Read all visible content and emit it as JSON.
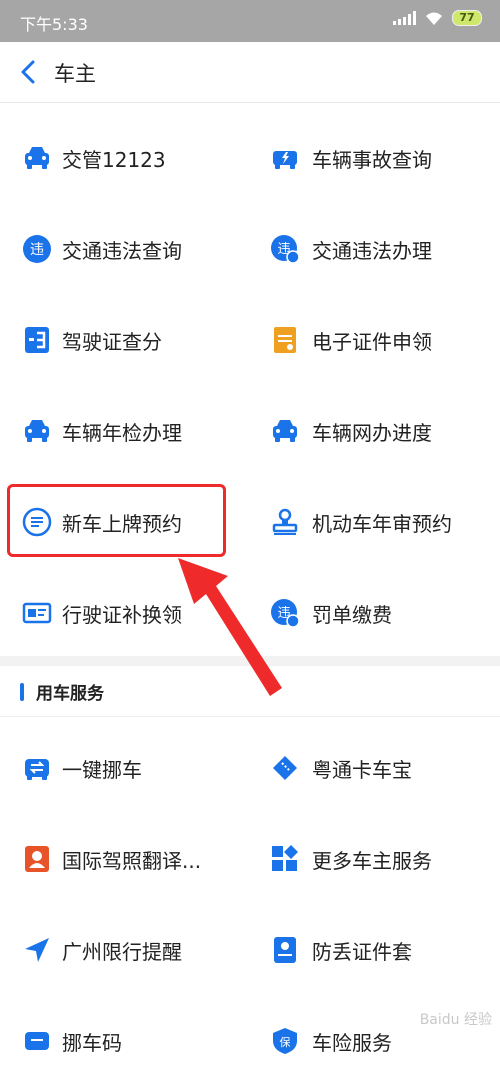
{
  "status": {
    "time": "下午5:33",
    "battery": "77"
  },
  "nav": {
    "title": "车主"
  },
  "services": [
    {
      "label": "交管12123",
      "icon": "car-icon"
    },
    {
      "label": "车辆事故查询",
      "icon": "car-accident-icon"
    },
    {
      "label": "交通违法查询",
      "icon": "violation-icon"
    },
    {
      "label": "交通违法办理",
      "icon": "violation-handle-icon"
    },
    {
      "label": "驾驶证查分",
      "icon": "license-points-icon"
    },
    {
      "label": "电子证件申领",
      "icon": "e-certificate-icon"
    },
    {
      "label": "车辆年检办理",
      "icon": "car-icon"
    },
    {
      "label": "车辆网办进度",
      "icon": "car-icon"
    },
    {
      "label": "新车上牌预约",
      "icon": "list-circle-icon"
    },
    {
      "label": "机动车年审预约",
      "icon": "stamp-icon"
    },
    {
      "label": "行驶证补换领",
      "icon": "id-card-icon"
    },
    {
      "label": "罚单缴费",
      "icon": "violation-pay-icon"
    }
  ],
  "car_services": {
    "title": "用车服务",
    "items": [
      {
        "label": "一键挪车",
        "icon": "move-car-icon"
      },
      {
        "label": "粤通卡车宝",
        "icon": "ticket-icon"
      },
      {
        "label": "国际驾照翻译...",
        "icon": "person-card-icon"
      },
      {
        "label": "更多车主服务",
        "icon": "grid-plus-icon"
      },
      {
        "label": "广州限行提醒",
        "icon": "navigation-arrow-icon"
      },
      {
        "label": "防丢证件套",
        "icon": "card-holder-icon"
      },
      {
        "label": "挪车码",
        "icon": "car-code-icon"
      },
      {
        "label": "车险服务",
        "icon": "insurance-icon"
      }
    ]
  },
  "colors": {
    "accent": "#1a73e8",
    "orange": "#f0a020",
    "highlight": "#ee2a2a"
  },
  "watermark": "Baidu 经验"
}
